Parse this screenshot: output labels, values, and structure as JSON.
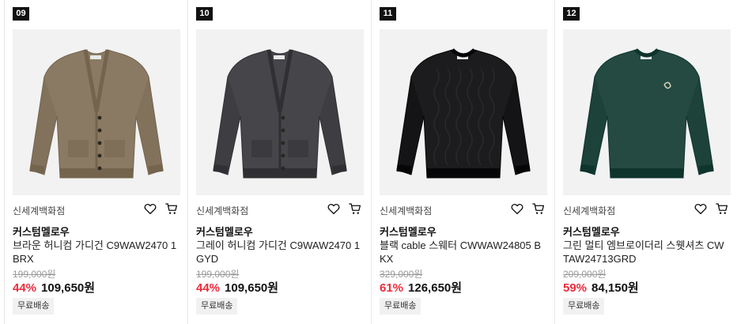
{
  "products": [
    {
      "rank": "09",
      "store": "신세계백화점",
      "brand": "커스텀멜로우",
      "name": "브라운 허니컴 가디건 C9WAW2470 1BRX",
      "original_price": "199,000원",
      "discount": "44%",
      "price": "109,650원",
      "badge": "무료배송",
      "garment": "cardigan",
      "color": "#8a7a64"
    },
    {
      "rank": "10",
      "store": "신세계백화점",
      "brand": "커스텀멜로우",
      "name": "그레이 허니컴 가디건 C9WAW2470 1GYD",
      "original_price": "199,000원",
      "discount": "44%",
      "price": "109,650원",
      "badge": "무료배송",
      "garment": "cardigan",
      "color": "#46464a"
    },
    {
      "rank": "11",
      "store": "신세계백화점",
      "brand": "커스텀멜로우",
      "name": "블랙 cable 스웨터 CWWAW24805 BKX",
      "original_price": "329,000원",
      "discount": "61%",
      "price": "126,650원",
      "badge": "무료배송",
      "garment": "sweater",
      "color": "#1c1c1e"
    },
    {
      "rank": "12",
      "store": "신세계백화점",
      "brand": "커스텀멜로우",
      "name": "그린 멀티 엠브로이더리 스웻셔츠 CW TAW24713GRD",
      "original_price": "209,000원",
      "discount": "59%",
      "price": "84,150원",
      "badge": "무료배송",
      "garment": "sweatshirt",
      "color": "#244a42"
    }
  ],
  "icons": {
    "wishlist": "heart-icon",
    "cart": "cart-icon"
  },
  "colors": {
    "discount": "#ee2b3b",
    "rank_bg": "#111111",
    "badge_bg": "#f1f1f1"
  }
}
